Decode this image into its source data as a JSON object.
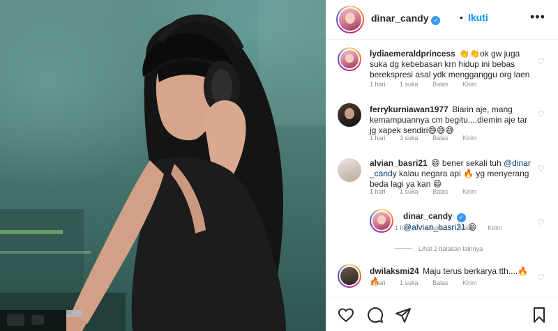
{
  "post": {
    "author": "dinar_candy",
    "separator": "•",
    "follow_label": "Ikuti",
    "more_label": "•••"
  },
  "comments": [
    {
      "username": "lydiaemeraldprincess",
      "text": "👏👏ok gw juga suka dg kebebasan krn hidup ini bebas berekspresi asal ydk mengganggu org laen",
      "time": "1 hari",
      "likes": "1 suka",
      "reply_label": "Balas",
      "send_label": "Kirim"
    },
    {
      "username": "ferrykurniawan1977",
      "text": "Biarin aje, mang kemampuannya cm begitu....diemin aje tar jg xapek sendiri😅😅😅",
      "time": "1 hari",
      "likes": "3 suka",
      "reply_label": "Balas",
      "send_label": "Kirim"
    },
    {
      "username": "alvian_basri21",
      "text_before": "😄 bener sekali tuh ",
      "mention": "@dinar _candy",
      "text_after": " kalau negara api 🔥 yg menyerang beda lagi ya kan 😄",
      "time": "1 hari",
      "likes": "1 suka",
      "reply_label": "Balas",
      "send_label": "Kirim"
    },
    {
      "username": "dwilaksmi24",
      "text": "Maju terus berkarya tth....🔥🔥",
      "time": "1 hari",
      "likes": "1 suka",
      "reply_label": "Balas",
      "send_label": "Kirim"
    }
  ],
  "reply": {
    "username": "dinar_candy",
    "mention": "@alvian_basri21",
    "emoji": " 😄",
    "time": "1 hari",
    "likes": "2 suka",
    "reply_label": "Balas",
    "send_label": "Kirim"
  },
  "view_more_replies": "Lihat 2 balasan lainnya",
  "colors": {
    "follow": "#0095f6",
    "verified": "#3897f0",
    "mention": "#00376b",
    "meta": "#8e8e8e"
  },
  "icons": {
    "like": "heart-icon",
    "comment": "comment-icon",
    "share": "paper-plane-icon",
    "save": "bookmark-icon",
    "verified": "verified-badge-icon"
  }
}
